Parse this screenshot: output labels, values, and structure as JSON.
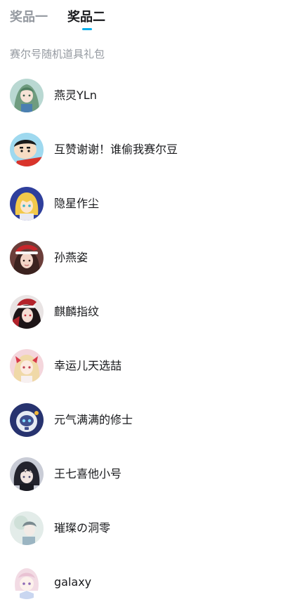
{
  "tabs": [
    {
      "label": "奖品一",
      "active": false
    },
    {
      "label": "奖品二",
      "active": true
    }
  ],
  "accent_color": "#00aeec",
  "section_title": "赛尔号随机道具礼包",
  "winners": [
    {
      "name": "燕灵YLn",
      "avatar": "green-hair-anime-avatar"
    },
    {
      "name": "互赞谢谢！谁偷我赛尔豆",
      "avatar": "crayon-shin-chan-avatar"
    },
    {
      "name": "隐星作尘",
      "avatar": "blonde-anime-girl-avatar"
    },
    {
      "name": "孙燕姿",
      "avatar": "santa-hat-girl-avatar"
    },
    {
      "name": "麒麟指纹",
      "avatar": "dark-santa-anime-avatar"
    },
    {
      "name": "幸运儿天选喆",
      "avatar": "blonde-anime-girl-avatar"
    },
    {
      "name": "元气满满的修士",
      "avatar": "robot-avatar"
    },
    {
      "name": "王七喜他小号",
      "avatar": "dark-hair-anime-boy-avatar"
    },
    {
      "name": "璀璨の洞零",
      "avatar": "faded-portrait-avatar"
    },
    {
      "name": "galaxy",
      "avatar": "chibi-anime-avatar"
    }
  ]
}
